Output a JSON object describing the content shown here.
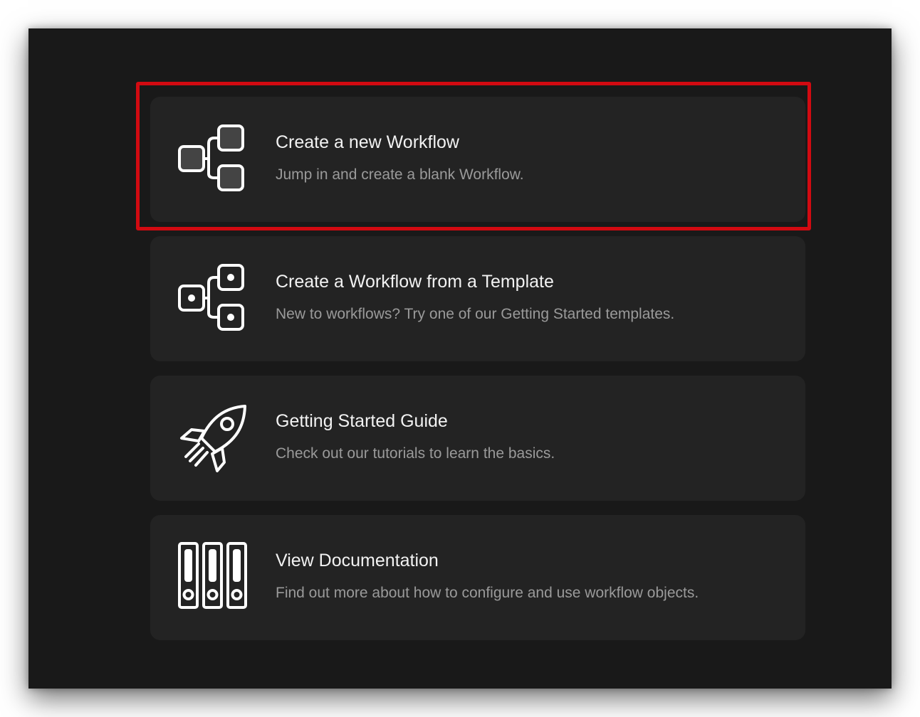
{
  "cards": [
    {
      "title": "Create a new Workflow",
      "subtitle": "Jump in and create a blank Workflow.",
      "icon": "workflow-blank-icon"
    },
    {
      "title": "Create a Workflow from a Template",
      "subtitle": "New to workflows? Try one of our Getting Started templates.",
      "icon": "workflow-template-icon"
    },
    {
      "title": "Getting Started Guide",
      "subtitle": "Check out our tutorials to learn the basics.",
      "icon": "rocket-icon"
    },
    {
      "title": "View Documentation",
      "subtitle": "Find out more about how to configure and use workflow objects.",
      "icon": "documentation-binders-icon"
    }
  ],
  "colors": {
    "window_background": "#191919",
    "card_background": "#232323",
    "title_text": "#f2f2f2",
    "subtitle_text": "#9a9a9a",
    "highlight": "#d20a11"
  },
  "highlighted_card": 0
}
